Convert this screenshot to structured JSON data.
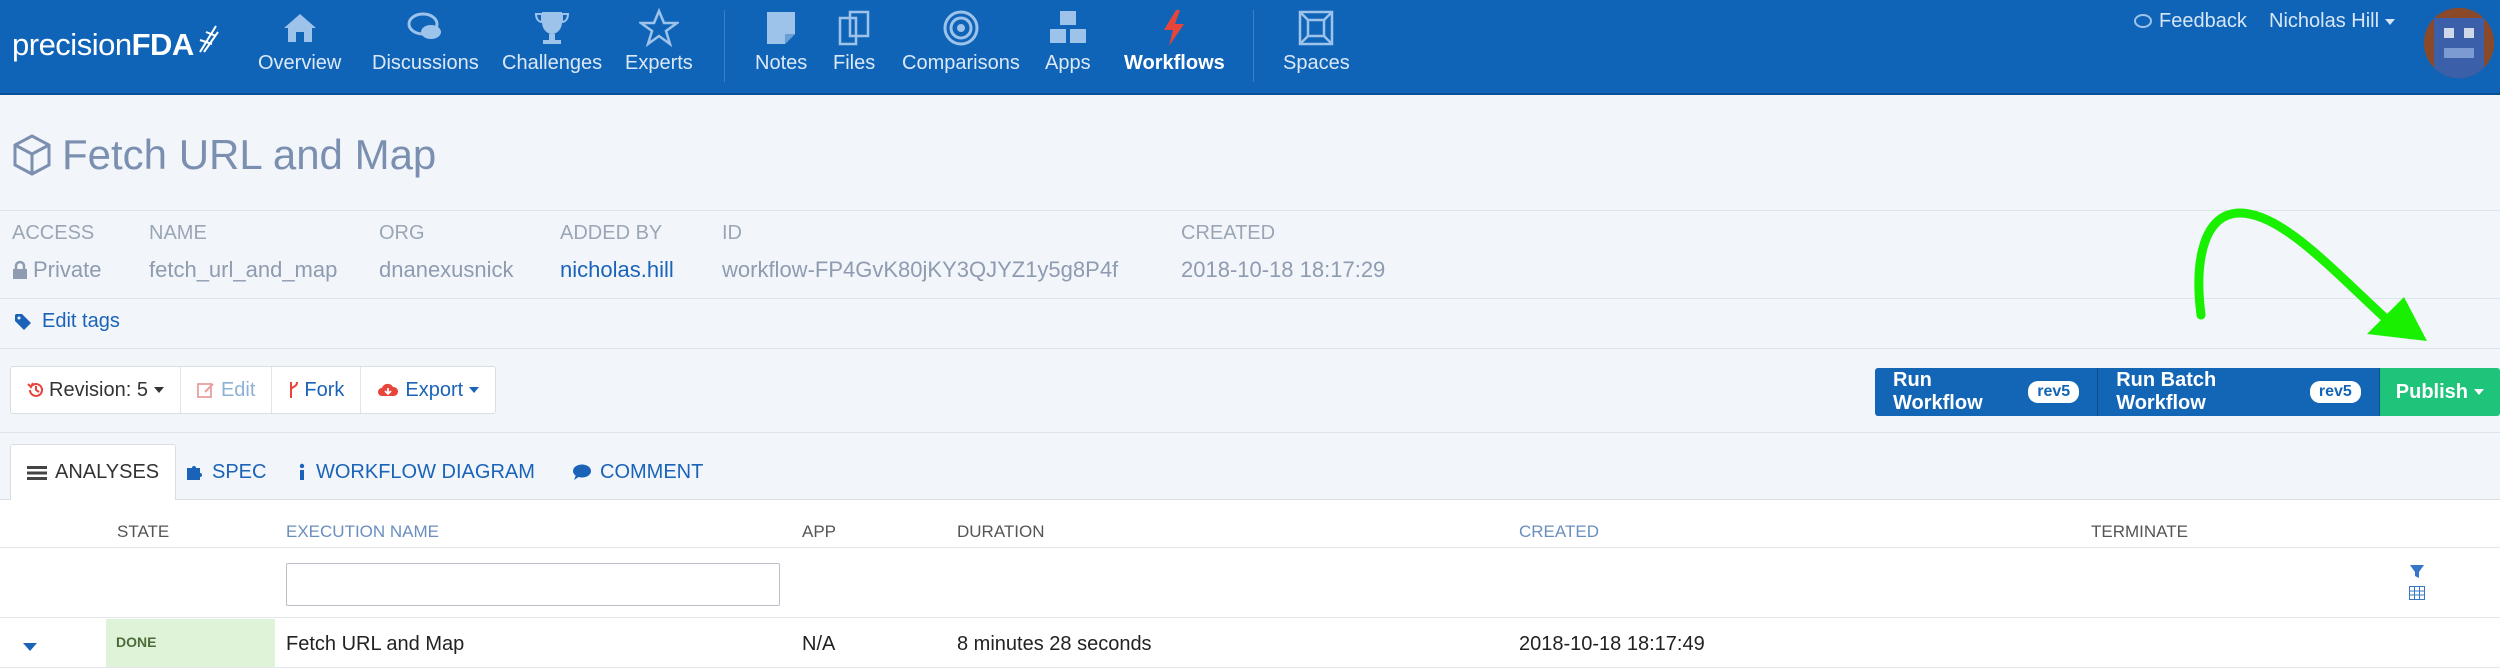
{
  "brand": {
    "name_part1": "precision",
    "name_part2": "FDA"
  },
  "nav": {
    "items": [
      {
        "label": "Overview",
        "icon": "home-icon"
      },
      {
        "label": "Discussions",
        "icon": "chat-icon"
      },
      {
        "label": "Challenges",
        "icon": "trophy-icon"
      },
      {
        "label": "Experts",
        "icon": "star-icon"
      },
      {
        "label": "Notes",
        "icon": "note-icon"
      },
      {
        "label": "Files",
        "icon": "files-icon"
      },
      {
        "label": "Comparisons",
        "icon": "target-icon"
      },
      {
        "label": "Apps",
        "icon": "cubes-icon"
      },
      {
        "label": "Workflows",
        "icon": "bolt-icon",
        "active": true
      },
      {
        "label": "Spaces",
        "icon": "spaces-icon"
      }
    ],
    "feedback": "Feedback",
    "user": "Nicholas Hill"
  },
  "page": {
    "title": "Fetch URL and Map",
    "meta": {
      "access_label": "ACCESS",
      "access_value": "Private",
      "name_label": "NAME",
      "name_value": "fetch_url_and_map",
      "org_label": "ORG",
      "org_value": "dnanexusnick",
      "added_by_label": "ADDED BY",
      "added_by_value": "nicholas.hill",
      "id_label": "ID",
      "id_value": "workflow-FP4GvK80jKY3QJYZ1y5g8P4f",
      "created_label": "CREATED",
      "created_value": "2018-10-18 18:17:29"
    },
    "edit_tags": "Edit tags"
  },
  "actions": {
    "revision_label": "Revision:",
    "revision_value": "5",
    "edit": "Edit",
    "fork": "Fork",
    "export": "Export",
    "run_workflow": "Run Workflow",
    "run_workflow_badge": "rev5",
    "run_batch_workflow": "Run Batch Workflow",
    "run_batch_badge": "rev5",
    "publish": "Publish"
  },
  "tabs": {
    "analyses": "ANALYSES",
    "spec": "SPEC",
    "workflow_diagram": "WORKFLOW DIAGRAM",
    "comment": "COMMENT"
  },
  "table": {
    "columns": [
      "STATE",
      "EXECUTION NAME",
      "APP",
      "DURATION",
      "CREATED",
      "TERMINATE"
    ],
    "rows": [
      {
        "state": "DONE",
        "name": "Fetch URL and Map",
        "app": "N/A",
        "duration": "8 minutes 28 seconds",
        "created": "2018-10-18 18:17:49"
      }
    ]
  },
  "colors": {
    "navbar": "#1064b8",
    "primary": "#1365b5",
    "publish": "#1dc47a",
    "annotation_arrow": "#19f000"
  }
}
